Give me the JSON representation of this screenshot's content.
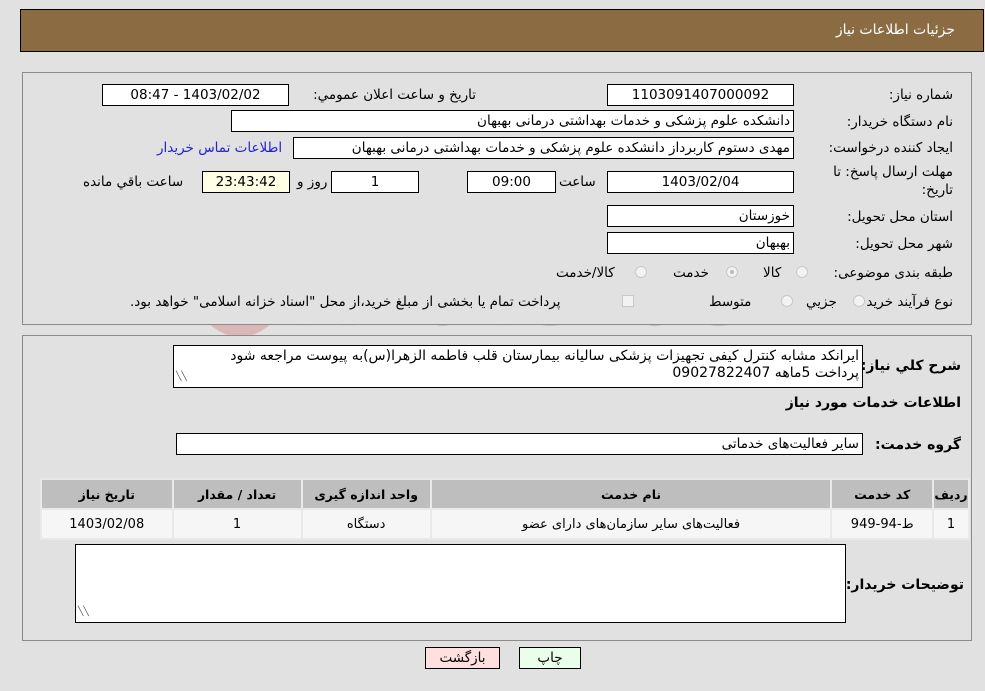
{
  "header": {
    "title": "جزئیات اطلاعات نیاز"
  },
  "fields": {
    "need_number_label": "شماره نیاز:",
    "need_number": "1103091407000092",
    "announce_label": "تاريخ و ساعت اعلان عمومي:",
    "announce_value": "1403/02/02 - 08:47",
    "buyer_org_label": "نام دستگاه خريدار:",
    "buyer_org": "دانشکده علوم پزشکی و خدمات بهداشتی  درمانی بهبهان",
    "creator_label": "ايجاد کننده درخواست:",
    "creator": "مهدی دستوم کاربرداز دانشکده علوم پزشکی و خدمات بهداشتی  درمانی بهبهان",
    "contact_link": "اطلاعات تماس خريدار",
    "deadline_label_1": "مهلت ارسال پاسخ: تا",
    "deadline_label_2": "تاریخ:",
    "deadline_date": "1403/02/04",
    "time_label": "ساعت",
    "deadline_time": "09:00",
    "days": "1",
    "days_label": "روز و",
    "remaining": "23:43:42",
    "remaining_label": "ساعت باقي مانده",
    "province_label": "استان محل تحویل:",
    "province": "خوزستان",
    "city_label": "شهر محل تحویل:",
    "city": "بهبهان",
    "category_label": "طبقه بندی موضوعی:",
    "category_options": [
      "کالا",
      "خدمت",
      "کالا/خدمت"
    ],
    "category_selected": "خدمت",
    "process_label": "نوع فرآيند خريد :",
    "process_options": [
      "جزيي",
      "متوسط"
    ],
    "treasury_note": "پرداخت تمام یا بخشی از مبلغ خرید،از محل \"اسناد خزانه اسلامی\" خواهد بود."
  },
  "details": {
    "description_label": "شرح کلي نياز:",
    "description_line1": "ایرانکد مشابه کنترل کیفی  تجهیزات پزشکی سالیانه بیمارستان قلب فاطمه الزهرا(س)به پیوست مراجعه شود",
    "description_line2": "پرداخت 5ماهه 09027822407",
    "services_heading": "اطلاعات خدمات مورد نياز",
    "service_group_label": "گروه خدمت:",
    "service_group": "سایر فعالیت‌های خدماتی",
    "table": {
      "headers": [
        "رديف",
        "کد خدمت",
        "نام خدمت",
        "واحد اندازه گیری",
        "تعداد / مقدار",
        "تاریخ نیاز"
      ],
      "rows": [
        [
          "1",
          "ط-94-949",
          "فعالیت‌های سایر سازمان‌های دارای عضو",
          "دستگاه",
          "1",
          "1403/02/08"
        ]
      ]
    },
    "buyer_notes_label": "توضيحات خريدار:",
    "buyer_notes": ""
  },
  "buttons": {
    "print": "چاپ",
    "back": "بازگشت"
  },
  "colors": {
    "header_bg": "#8b6c42",
    "print_bg": "#eaffea",
    "back_bg": "#ffe0e0",
    "link": "#2222cc"
  }
}
